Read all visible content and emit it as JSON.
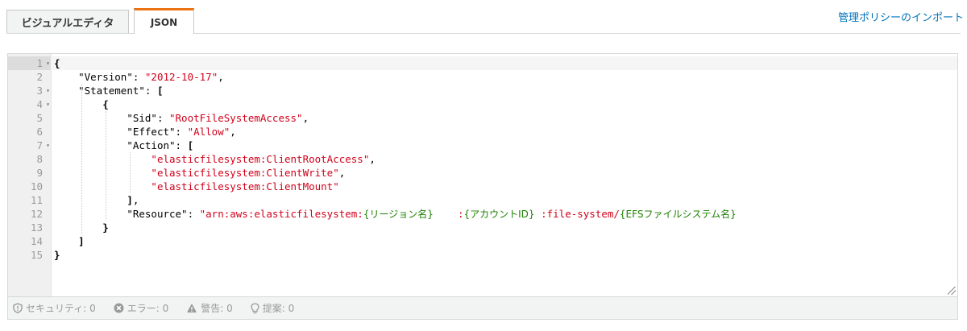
{
  "tabs": {
    "visual_label": "ビジュアルエディタ",
    "json_label": "JSON"
  },
  "import_link": "管理ポリシーのインポート",
  "editor": {
    "lines": [
      {
        "num": "1",
        "fold": true,
        "indent": "",
        "parts": [
          [
            "b",
            "{"
          ]
        ]
      },
      {
        "num": "2",
        "fold": false,
        "indent": "    ",
        "parts": [
          [
            "k",
            "\"Version\": "
          ],
          [
            "s",
            "\"2012-10-17\""
          ],
          [
            "k",
            ","
          ]
        ]
      },
      {
        "num": "3",
        "fold": true,
        "indent": "    ",
        "parts": [
          [
            "k",
            "\"Statement\": "
          ],
          [
            "b",
            "["
          ]
        ]
      },
      {
        "num": "4",
        "fold": true,
        "indent": "        ",
        "parts": [
          [
            "b",
            "{"
          ]
        ]
      },
      {
        "num": "5",
        "fold": false,
        "indent": "            ",
        "parts": [
          [
            "k",
            "\"Sid\": "
          ],
          [
            "s",
            "\"RootFileSystemAccess\""
          ],
          [
            "k",
            ","
          ]
        ]
      },
      {
        "num": "6",
        "fold": false,
        "indent": "            ",
        "parts": [
          [
            "k",
            "\"Effect\": "
          ],
          [
            "s",
            "\"Allow\""
          ],
          [
            "k",
            ","
          ]
        ]
      },
      {
        "num": "7",
        "fold": true,
        "indent": "            ",
        "parts": [
          [
            "k",
            "\"Action\": "
          ],
          [
            "b",
            "["
          ]
        ]
      },
      {
        "num": "8",
        "fold": false,
        "indent": "                ",
        "parts": [
          [
            "s",
            "\"elasticfilesystem:ClientRootAccess\""
          ],
          [
            "k",
            ","
          ]
        ]
      },
      {
        "num": "9",
        "fold": false,
        "indent": "                ",
        "parts": [
          [
            "s",
            "\"elasticfilesystem:ClientWrite\""
          ],
          [
            "k",
            ","
          ]
        ]
      },
      {
        "num": "10",
        "fold": false,
        "indent": "                ",
        "parts": [
          [
            "s",
            "\"elasticfilesystem:ClientMount\""
          ]
        ]
      },
      {
        "num": "11",
        "fold": false,
        "indent": "            ",
        "parts": [
          [
            "b",
            "]"
          ],
          [
            "k",
            ","
          ]
        ]
      },
      {
        "num": "12",
        "fold": false,
        "indent": "            ",
        "parts": [
          [
            "k",
            "\"Resource\": "
          ],
          [
            "s",
            "\"arn:aws:elasticfilesystem:"
          ],
          [
            "ph",
            "{リージョン名}"
          ],
          [
            "s",
            "    :"
          ],
          [
            "ph",
            "{アカウントID}"
          ],
          [
            "s",
            " :file-system/"
          ],
          [
            "ph",
            "{EFSファイルシステム名}"
          ]
        ]
      },
      {
        "num": "13",
        "fold": false,
        "indent": "        ",
        "parts": [
          [
            "b",
            "}"
          ]
        ]
      },
      {
        "num": "14",
        "fold": false,
        "indent": "    ",
        "parts": [
          [
            "b",
            "]"
          ]
        ]
      },
      {
        "num": "15",
        "fold": false,
        "indent": "",
        "parts": [
          [
            "b",
            "}"
          ]
        ]
      }
    ]
  },
  "status": {
    "security": "セキュリティ: 0",
    "errors": "エラー: 0",
    "warnings": "警告: 0",
    "suggestions": "提案: 0"
  },
  "colors": {
    "accent_tab": "#ec7211",
    "link": "#0073bb",
    "string": "#d0021b",
    "placeholder": "#1d8102"
  }
}
